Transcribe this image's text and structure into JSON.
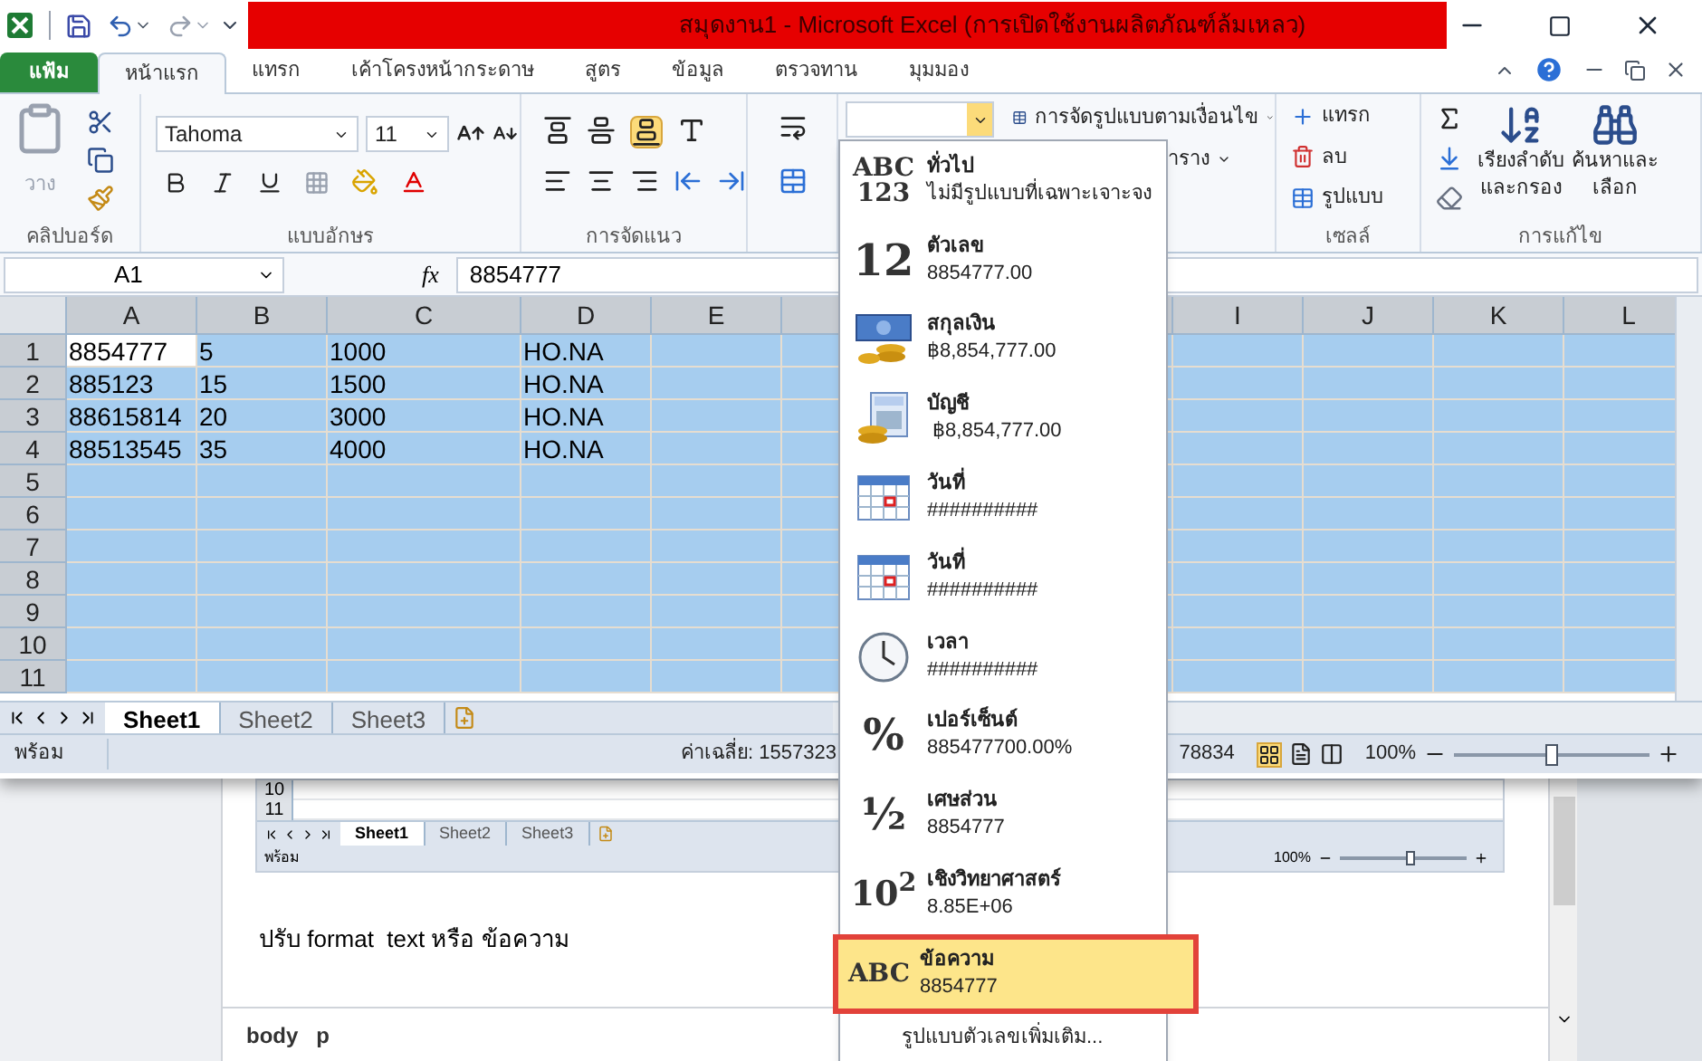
{
  "title_bar": {
    "title": "สมุดงาน1  -  Microsoft Excel (การเปิดใช้งานผลิตภัณฑ์ล้มเหลว)"
  },
  "ribbon_tabs": [
    {
      "label": "แฟ้ม",
      "kind": "file",
      "selected": false
    },
    {
      "label": "หน้าแรก",
      "kind": "tab",
      "selected": true
    },
    {
      "label": "แทรก",
      "kind": "tab",
      "selected": false
    },
    {
      "label": "เค้าโครงหน้ากระดาษ",
      "kind": "tab",
      "selected": false
    },
    {
      "label": "สูตร",
      "kind": "tab",
      "selected": false
    },
    {
      "label": "ข้อมูล",
      "kind": "tab",
      "selected": false
    },
    {
      "label": "ตรวจทาน",
      "kind": "tab",
      "selected": false
    },
    {
      "label": "มุมมอง",
      "kind": "tab",
      "selected": false
    }
  ],
  "clipboard": {
    "paste": "วาง",
    "group": "คลิปบอร์ด"
  },
  "font": {
    "name": "Tahoma",
    "size": "11",
    "group": "แบบอักษร"
  },
  "alignment": {
    "group": "การจัดแนว"
  },
  "styles": {
    "conditional": "การจัดรูปแบบตามเงื่อนไข",
    "table": "าราง"
  },
  "cells": {
    "insert": "แทรก",
    "delete": "ลบ",
    "format": "รูปแบบ",
    "group": "เซลล์"
  },
  "editing": {
    "sort": [
      "เรียงลำดับ",
      "และกรอง"
    ],
    "find": [
      "ค้นหาและ",
      "เลือก"
    ],
    "group": "การแก้ไข"
  },
  "formula_bar": {
    "name_box": "A1",
    "insert_function": "fx",
    "value": "8854777"
  },
  "grid": {
    "columns": [
      {
        "kind": "header",
        "label": "A"
      },
      {
        "kind": "header",
        "label": "B"
      },
      {
        "kind": "header",
        "label": "C"
      },
      {
        "kind": "header",
        "label": "D"
      },
      {
        "kind": "header",
        "label": "E"
      },
      {
        "kind": "covered"
      },
      {
        "kind": "covered"
      },
      {
        "kind": "header",
        "label": "I"
      },
      {
        "kind": "header",
        "label": "J"
      },
      {
        "kind": "header",
        "label": "K"
      },
      {
        "kind": "header",
        "label": "L"
      }
    ],
    "rows": [
      {
        "header": "1",
        "selected": true,
        "cells": [
          {
            "value": "8854777",
            "active": true
          },
          {
            "value": "5",
            "active": false
          },
          {
            "value": "1000",
            "active": false
          },
          {
            "value": "HO.NA",
            "active": false
          }
        ]
      },
      {
        "header": "2",
        "selected": true,
        "cells": [
          {
            "value": "885123",
            "active": false
          },
          {
            "value": "15",
            "active": false
          },
          {
            "value": "1500",
            "active": false
          },
          {
            "value": "HO.NA",
            "active": false
          }
        ]
      },
      {
        "header": "3",
        "selected": true,
        "cells": [
          {
            "value": "88615814",
            "active": false
          },
          {
            "value": "20",
            "active": false
          },
          {
            "value": "3000",
            "active": false
          },
          {
            "value": "HO.NA",
            "active": false
          }
        ]
      },
      {
        "header": "4",
        "selected": true,
        "cells": [
          {
            "value": "88513545",
            "active": false
          },
          {
            "value": "35",
            "active": false
          },
          {
            "value": "4000",
            "active": false
          },
          {
            "value": "HO.NA",
            "active": false
          }
        ]
      },
      {
        "header": "5",
        "selected": true
      },
      {
        "header": "6",
        "selected": true
      },
      {
        "header": "7",
        "selected": true
      },
      {
        "header": "8",
        "selected": true
      },
      {
        "header": "9",
        "selected": true
      },
      {
        "header": "10",
        "selected": true
      },
      {
        "header": "11",
        "selected": true
      }
    ]
  },
  "sheet_tabs": [
    {
      "label": "Sheet1",
      "selected": true
    },
    {
      "label": "Sheet2",
      "selected": false
    },
    {
      "label": "Sheet3",
      "selected": false
    }
  ],
  "status_bar": {
    "ready": "พร้อม",
    "average": "ค่าเฉลี่ย: 1557323",
    "sum_partial": "78834",
    "zoom": "100%",
    "level": 0.5
  },
  "number_format_menu": {
    "items": [
      {
        "kind": "glyph",
        "glyph": [
          "ABC",
          "123"
        ],
        "title": "ทั่วไป",
        "sample": "ไม่มีรูปแบบที่เฉพาะเจาะจง",
        "selected": false
      },
      {
        "kind": "glyph",
        "glyph": [
          "12"
        ],
        "title": "ตัวเลข",
        "sample": "8854777.00",
        "selected": false
      },
      {
        "kind": "currency",
        "title": "สกุลเงิน",
        "sample": "฿8,854,777.00",
        "selected": false
      },
      {
        "kind": "accounting",
        "title": "บัญชี",
        "sample": " ฿8,854,777.00",
        "selected": false
      },
      {
        "kind": "calendar",
        "title": "วันที่",
        "sample": "##########",
        "selected": false
      },
      {
        "kind": "calendar",
        "title": "วันที่",
        "sample": "##########",
        "selected": false
      },
      {
        "kind": "clock",
        "title": "เวลา",
        "sample": "##########",
        "selected": false
      },
      {
        "kind": "glyph",
        "glyph": [
          "%"
        ],
        "title": "เปอร์เซ็นต์",
        "sample": "885477700.00%",
        "selected": false
      },
      {
        "kind": "glyph",
        "glyph": [
          "½"
        ],
        "title": "เศษส่วน",
        "sample": "8854777",
        "selected": false
      },
      {
        "kind": "glyph",
        "glyph": [
          "10$^{2}$"
        ],
        "title": "เชิงวิทยาศาสตร์",
        "sample": "8.85E+06",
        "selected": false
      },
      {
        "kind": "glyph",
        "glyph": [
          "ABC"
        ],
        "title": "ข้อความ",
        "sample": "8854777",
        "selected": true
      }
    ],
    "more": "รูปแบบตัวเลขเพิ่มเติม..."
  },
  "editor": {
    "embedded_screenshot": {
      "rows": [
        "10",
        "11"
      ],
      "sheet_tabs": [
        {
          "label": "Sheet1",
          "selected": true
        },
        {
          "label": "Sheet2",
          "selected": false
        },
        {
          "label": "Sheet3",
          "selected": false
        }
      ],
      "ready": "พร้อม",
      "zoom": "100%",
      "level": 0.55
    },
    "paragraph": "ปรับ format  text หรือ ข้อความ",
    "path": [
      "body",
      "p"
    ]
  }
}
